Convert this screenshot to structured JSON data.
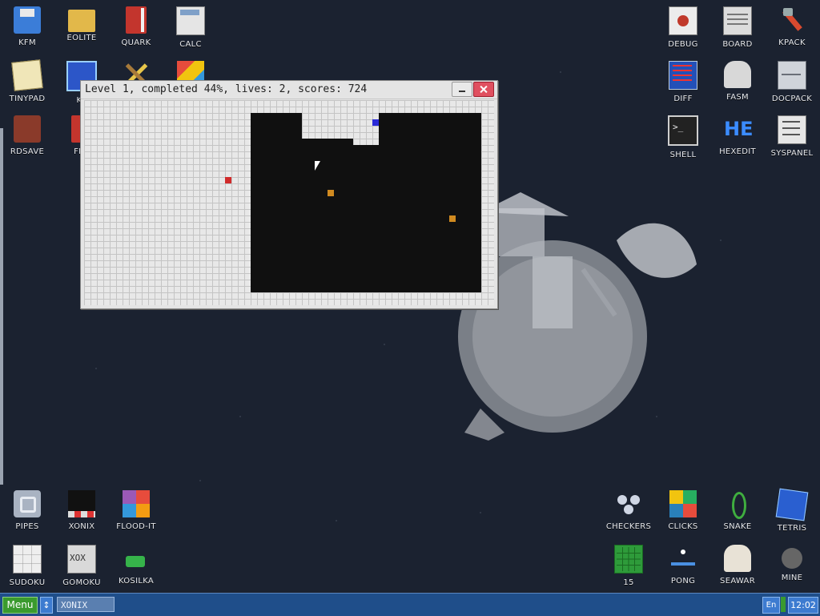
{
  "desktop": {
    "icons_left_top": [
      {
        "label": "KFM",
        "icon": "floppy-icon"
      },
      {
        "label": "EOLITE",
        "icon": "folder-icon"
      },
      {
        "label": "QUARK",
        "icon": "book-icon"
      },
      {
        "label": "CALC",
        "icon": "calculator-icon"
      },
      {
        "label": "TINYPAD",
        "icon": "notepad-icon"
      },
      {
        "label": "KF",
        "icon": "kf-icon"
      },
      {
        "label": "RDSAVE",
        "icon": "disk-save-icon"
      },
      {
        "label": "FB2",
        "icon": "fb2-book-icon"
      }
    ],
    "icons_right_top": [
      {
        "label": "DEBUG",
        "icon": "bug-icon"
      },
      {
        "label": "BOARD",
        "icon": "board-icon"
      },
      {
        "label": "KPACK",
        "icon": "wrench-icon"
      },
      {
        "label": "DIFF",
        "icon": "diff-icon"
      },
      {
        "label": "FASM",
        "icon": "fasm-icon"
      },
      {
        "label": "DOCPACK",
        "icon": "cabinet-icon"
      },
      {
        "label": "SHELL",
        "icon": "terminal-icon"
      },
      {
        "label": "HEXEDIT",
        "icon": "hexedit-icon",
        "glyph_text": "HE"
      },
      {
        "label": "SYSPANEL",
        "icon": "sliders-icon"
      }
    ],
    "icons_left_bottom": [
      {
        "label": "PIPES",
        "icon": "pipes-icon"
      },
      {
        "label": "XONIX",
        "icon": "xonix-icon"
      },
      {
        "label": "FLOOD-IT",
        "icon": "flood-it-icon"
      },
      {
        "label": "SUDOKU",
        "icon": "sudoku-icon"
      },
      {
        "label": "GOMOKU",
        "icon": "gomoku-icon"
      },
      {
        "label": "KOSILKA",
        "icon": "lawnmower-icon"
      }
    ],
    "icons_right_bottom": [
      {
        "label": "CHECKERS",
        "icon": "checkers-icon"
      },
      {
        "label": "CLICKS",
        "icon": "clicks-icon"
      },
      {
        "label": "SNAKE",
        "icon": "snake-icon"
      },
      {
        "label": "TETRIS",
        "icon": "tetris-icon"
      },
      {
        "label": "15",
        "icon": "fifteen-puzzle-icon"
      },
      {
        "label": "PONG",
        "icon": "pong-icon"
      },
      {
        "label": "SEAWAR",
        "icon": "seawar-icon"
      },
      {
        "label": "MINE",
        "icon": "mine-icon"
      }
    ]
  },
  "game_window": {
    "title": "Level 1, completed 44%, lives: 2, scores: 724",
    "minimize_icon": "minimize-icon",
    "close_icon": "close-icon",
    "colors": {
      "filled": "#e8e8e8",
      "sea": "#101010",
      "player": "#2a2ad8",
      "land_enemy": "#d02a2a",
      "sea_enemy": "#d08a20"
    }
  },
  "taskbar": {
    "menu_label": "Menu",
    "switch_icon": "switch-arrows-icon",
    "task_label": "XONIX",
    "lang": "En",
    "clock": "12:02"
  }
}
